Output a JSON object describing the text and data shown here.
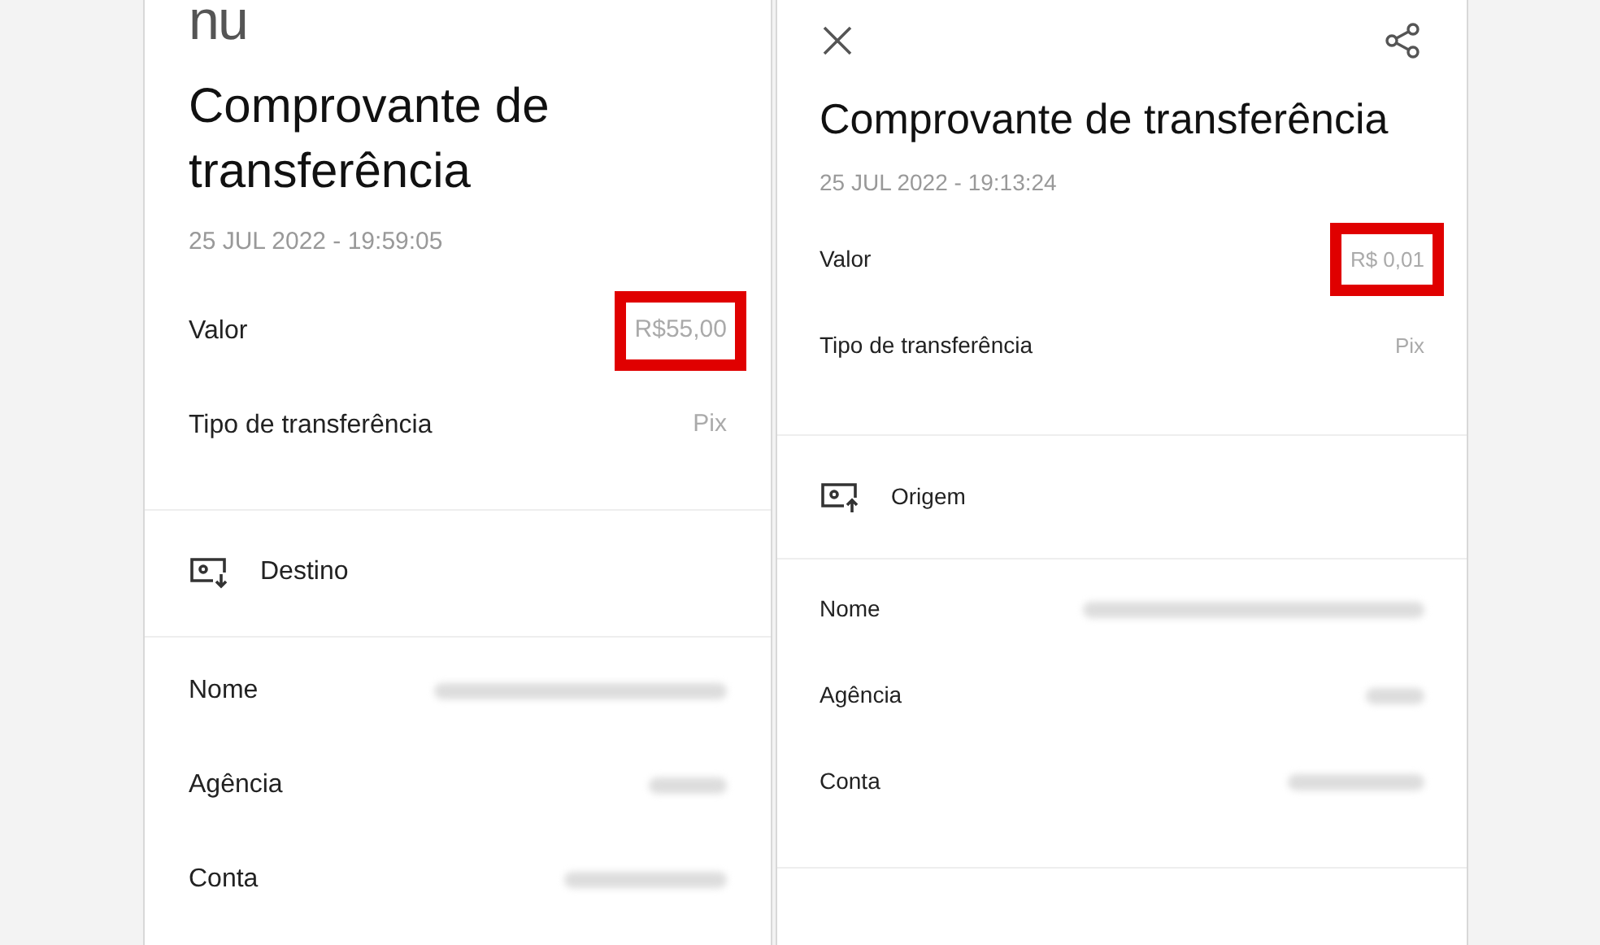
{
  "screens": [
    {
      "header": {
        "kind": "logo",
        "logo": "nu"
      },
      "title": "Comprovante de transferência",
      "date": "25 JUL 2022 - 19:59:05",
      "details": [
        {
          "label": "Valor",
          "value": "R$55,00",
          "highlighted": true
        },
        {
          "label": "Tipo de transferência",
          "value": "Pix",
          "highlighted": false
        }
      ],
      "party": {
        "kind": "destination",
        "label": "Destino"
      },
      "party_details": [
        {
          "label": "Nome",
          "redacted": true
        },
        {
          "label": "Agência",
          "redacted": true
        },
        {
          "label": "Conta",
          "redacted": true
        }
      ]
    },
    {
      "header": {
        "kind": "actions"
      },
      "title": "Comprovante de transferência",
      "date": "25 JUL 2022 - 19:13:24",
      "details": [
        {
          "label": "Valor",
          "value": "R$ 0,01",
          "highlighted": true
        },
        {
          "label": "Tipo de transferência",
          "value": "Pix",
          "highlighted": false
        }
      ],
      "party": {
        "kind": "origin",
        "label": "Origem"
      },
      "party_details": [
        {
          "label": "Nome",
          "redacted": true
        },
        {
          "label": "Agência",
          "redacted": true
        },
        {
          "label": "Conta",
          "redacted": true
        }
      ]
    }
  ]
}
